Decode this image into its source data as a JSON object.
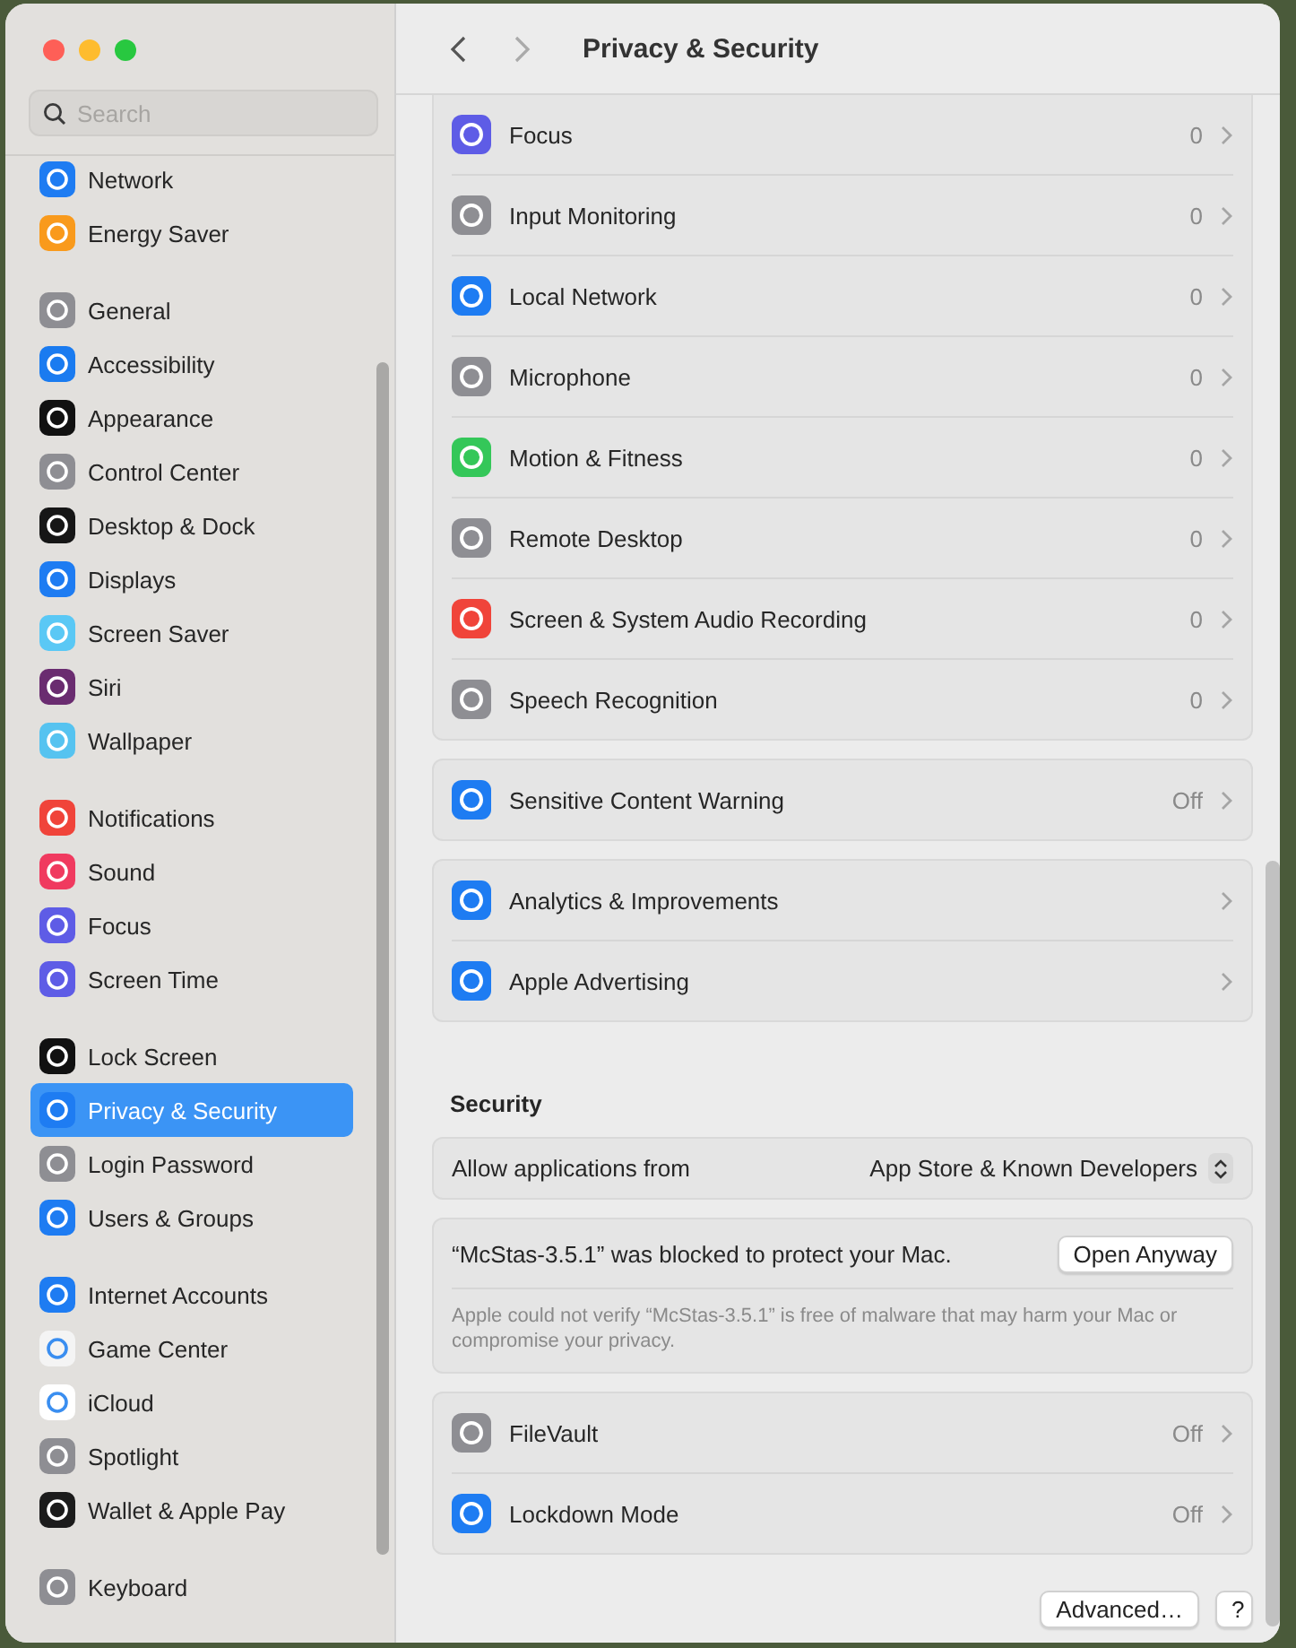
{
  "window": {
    "title": "Privacy & Security"
  },
  "sidebar": {
    "search": {
      "placeholder": "Search"
    },
    "groups": [
      {
        "items": [
          {
            "label": "Network",
            "color": "#1e7cf2",
            "selected": false
          },
          {
            "label": "Energy Saver",
            "color": "#f99a1c",
            "selected": false
          }
        ]
      },
      {
        "items": [
          {
            "label": "General",
            "color": "#8e8e93",
            "selected": false
          },
          {
            "label": "Accessibility",
            "color": "#1a7bf0",
            "selected": false
          },
          {
            "label": "Appearance",
            "color": "#111111",
            "selected": false
          },
          {
            "label": "Control Center",
            "color": "#8e8e93",
            "selected": false
          },
          {
            "label": "Desktop & Dock",
            "color": "#161616",
            "selected": false
          },
          {
            "label": "Displays",
            "color": "#1e7cf2",
            "selected": false
          },
          {
            "label": "Screen Saver",
            "color": "#5ac8f5",
            "selected": false
          },
          {
            "label": "Siri",
            "color": "#6a2c70",
            "selected": false
          },
          {
            "label": "Wallpaper",
            "color": "#56c3f0",
            "selected": false
          }
        ]
      },
      {
        "items": [
          {
            "label": "Notifications",
            "color": "#f0443a",
            "selected": false
          },
          {
            "label": "Sound",
            "color": "#f03a5f",
            "selected": false
          },
          {
            "label": "Focus",
            "color": "#5e5ce6",
            "selected": false
          },
          {
            "label": "Screen Time",
            "color": "#5e5ce6",
            "selected": false
          }
        ]
      },
      {
        "items": [
          {
            "label": "Lock Screen",
            "color": "#111111",
            "selected": false
          },
          {
            "label": "Privacy & Security",
            "color": "#1e7cf2",
            "selected": true
          },
          {
            "label": "Login Password",
            "color": "#8e8e93",
            "selected": false
          },
          {
            "label": "Users & Groups",
            "color": "#1e7cf2",
            "selected": false
          }
        ]
      },
      {
        "items": [
          {
            "label": "Internet Accounts",
            "color": "#1e7cf2",
            "selected": false
          },
          {
            "label": "Game Center",
            "color": "#f4f4f4",
            "selected": false
          },
          {
            "label": "iCloud",
            "color": "#ffffff",
            "selected": false
          },
          {
            "label": "Spotlight",
            "color": "#8e8e93",
            "selected": false
          },
          {
            "label": "Wallet & Apple Pay",
            "color": "#1c1c1c",
            "selected": false
          }
        ]
      },
      {
        "items": [
          {
            "label": "Keyboard",
            "color": "#8e8e93",
            "selected": false
          }
        ]
      }
    ]
  },
  "groups": [
    {
      "rows": [
        {
          "label": "Focus",
          "value": "0",
          "color": "#5e5ce6"
        },
        {
          "label": "Input Monitoring",
          "value": "0",
          "color": "#8e8e93"
        },
        {
          "label": "Local Network",
          "value": "0",
          "color": "#1e7cf2"
        },
        {
          "label": "Microphone",
          "value": "0",
          "color": "#8e8e93"
        },
        {
          "label": "Motion & Fitness",
          "value": "0",
          "color": "#34c759"
        },
        {
          "label": "Remote Desktop",
          "value": "0",
          "color": "#8e8e93"
        },
        {
          "label": "Screen & System Audio Recording",
          "value": "0",
          "color": "#f0443a"
        },
        {
          "label": "Speech Recognition",
          "value": "0",
          "color": "#8e8e93"
        }
      ]
    },
    {
      "rows": [
        {
          "label": "Sensitive Content Warning",
          "value": "Off",
          "color": "#1e7cf2"
        }
      ]
    },
    {
      "rows": [
        {
          "label": "Analytics & Improvements",
          "color": "#1e7cf2"
        },
        {
          "label": "Apple Advertising",
          "color": "#1e7cf2"
        }
      ]
    }
  ],
  "security": {
    "heading": "Security",
    "allow": {
      "label": "Allow applications from",
      "value": "App Store & Known Developers"
    },
    "blocked": {
      "message": "“McStas-3.5.1” was blocked to protect your Mac.",
      "button": "Open Anyway",
      "detail": "Apple could not verify “McStas-3.5.1” is free of malware that may harm your Mac or compromise your privacy."
    },
    "rows": [
      {
        "label": "FileVault",
        "value": "Off",
        "color": "#8e8e93"
      },
      {
        "label": "Lockdown Mode",
        "value": "Off",
        "color": "#1e7cf2"
      }
    ]
  },
  "footer": {
    "advanced_button": "Advanced…",
    "help_button": "?"
  }
}
